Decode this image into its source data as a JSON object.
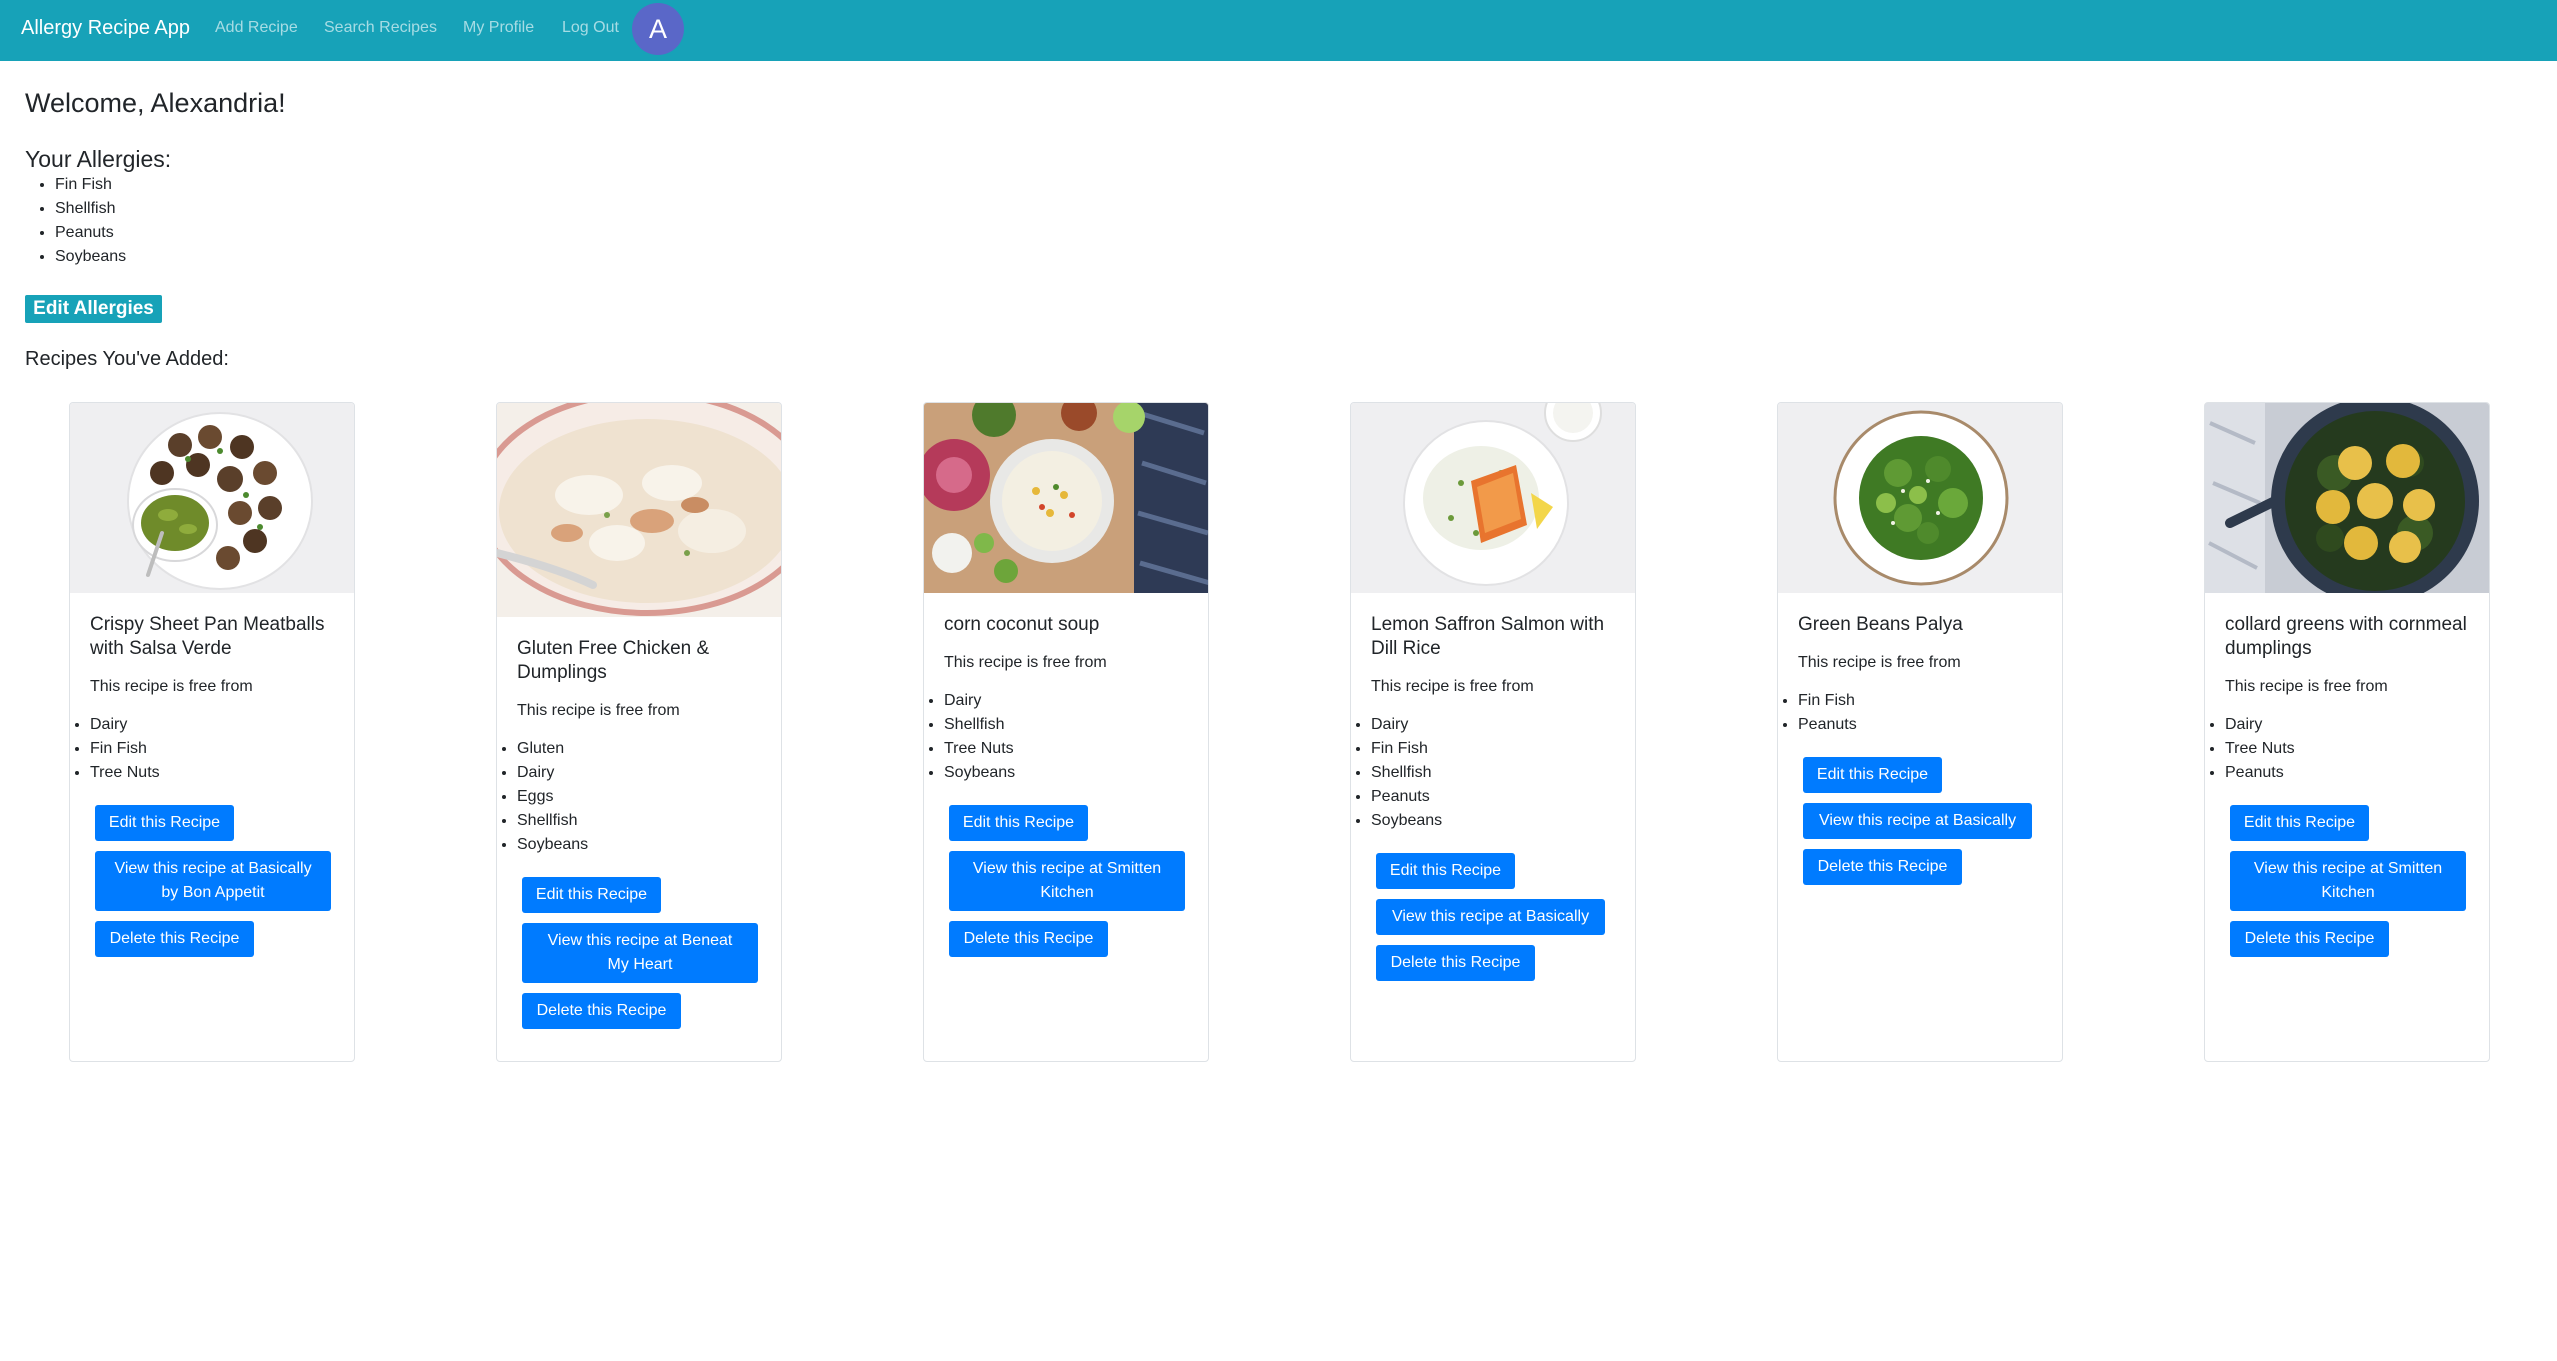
{
  "nav": {
    "brand": "Allergy Recipe App",
    "links": [
      "Add Recipe",
      "Search Recipes",
      "My Profile",
      "Log Out"
    ],
    "avatar_initial": "A"
  },
  "welcome": "Welcome, Alexandria!",
  "allergies": {
    "heading": "Your Allergies:",
    "items": [
      "Fin Fish",
      "Shellfish",
      "Peanuts",
      "Soybeans"
    ],
    "edit_button": "Edit Allergies"
  },
  "recipes_heading": "Recipes You've Added:",
  "free_from_label": "This recipe is free from",
  "edit_recipe_label": "Edit this Recipe",
  "delete_recipe_label": "Delete this Recipe",
  "recipes": [
    {
      "title": "Crispy Sheet Pan Meatballs with Salsa Verde",
      "free_from": [
        "Dairy",
        "Fin Fish",
        "Tree Nuts"
      ],
      "view_label": "View this recipe at Basically by Bon Appetit",
      "image": "meatballs-plate"
    },
    {
      "title": "Gluten Free Chicken & Dumplings",
      "free_from": [
        "Gluten",
        "Dairy",
        "Eggs",
        "Shellfish",
        "Soybeans"
      ],
      "view_label": "View this recipe at Beneat My Heart",
      "image": "chicken-dumplings-bowl"
    },
    {
      "title": "corn coconut soup",
      "free_from": [
        "Dairy",
        "Shellfish",
        "Tree Nuts",
        "Soybeans"
      ],
      "view_label": "View this recipe at Smitten Kitchen",
      "image": "corn-soup-bowl"
    },
    {
      "title": "Lemon Saffron Salmon with Dill Rice",
      "free_from": [
        "Dairy",
        "Fin Fish",
        "Shellfish",
        "Peanuts",
        "Soybeans"
      ],
      "view_label": "View this recipe at Basically",
      "image": "salmon-plate"
    },
    {
      "title": "Green Beans Palya",
      "free_from": [
        "Fin Fish",
        "Peanuts"
      ],
      "view_label": "View this recipe at Basically",
      "image": "green-beans-plate"
    },
    {
      "title": "collard greens with cornmeal dumplings",
      "free_from": [
        "Dairy",
        "Tree Nuts",
        "Peanuts"
      ],
      "view_label": "View this recipe at Smitten Kitchen",
      "image": "collard-greens-pan"
    }
  ]
}
